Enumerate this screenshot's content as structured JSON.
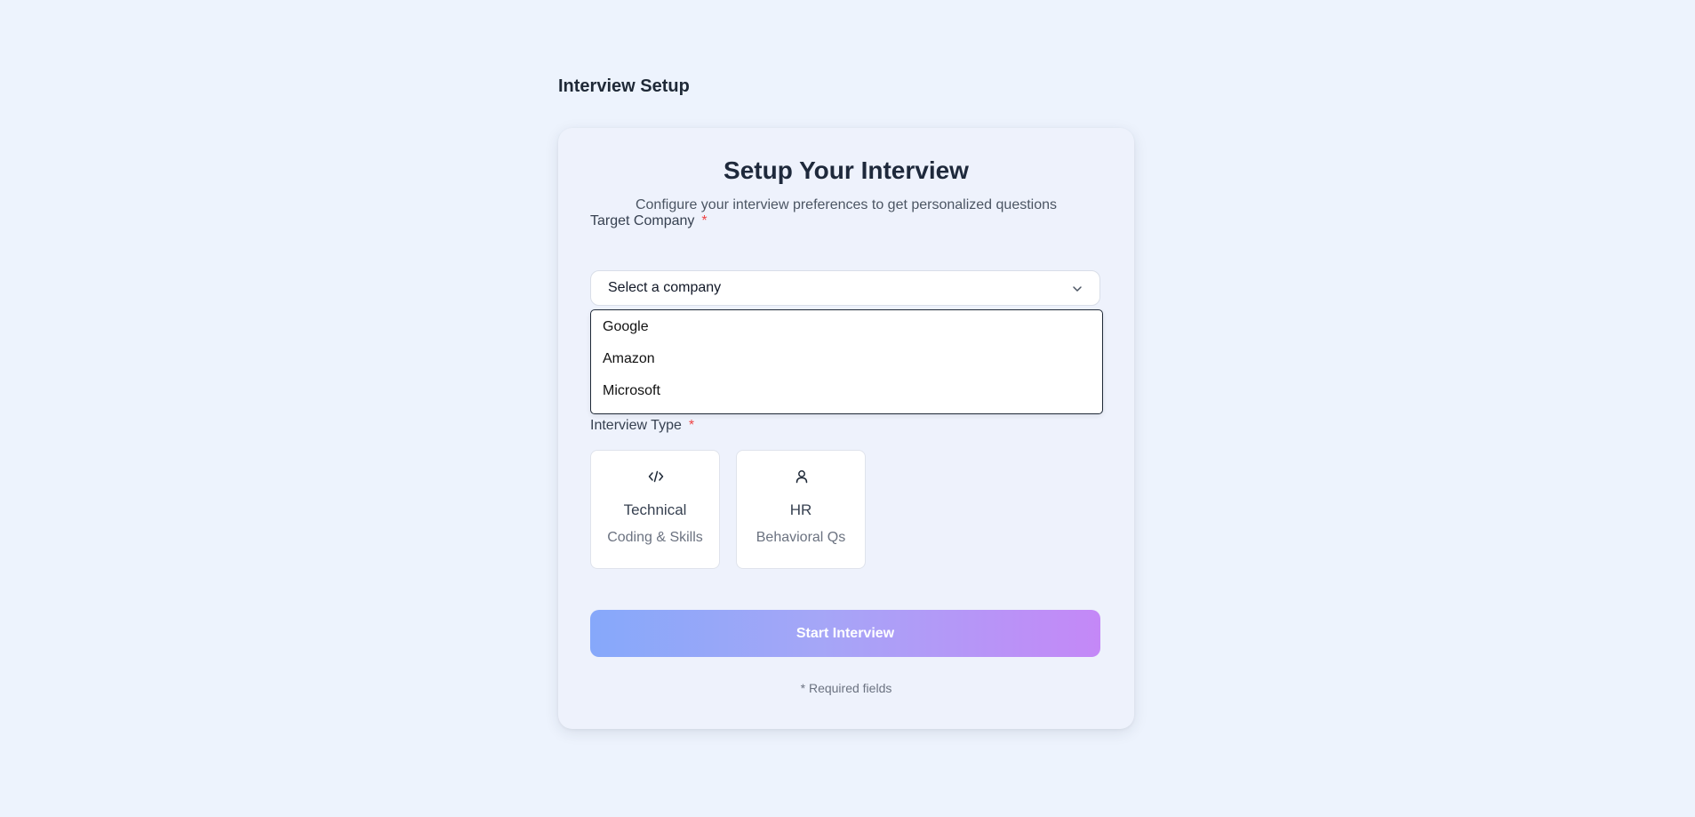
{
  "page": {
    "heading": "Interview Setup"
  },
  "card": {
    "title": "Setup Your Interview",
    "subtitle": "Configure your interview preferences to get personalized questions"
  },
  "company": {
    "label": "Target Company",
    "required_marker": "*",
    "selected_value": "Select a company",
    "options": [
      "Google",
      "Amazon",
      "Microsoft"
    ],
    "dropdown_open": true
  },
  "interview_type": {
    "label": "Interview Type",
    "required_marker": "*",
    "options": [
      {
        "title": "Technical",
        "subtitle": "Coding & Skills",
        "icon": "code-icon"
      },
      {
        "title": "HR",
        "subtitle": "Behavioral Qs",
        "icon": "user-icon"
      }
    ]
  },
  "actions": {
    "start_label": "Start Interview"
  },
  "footer": {
    "required_note": "* Required fields"
  },
  "colors": {
    "background": "#edf3fd",
    "card": "#eef2fc",
    "required": "#ef4444",
    "button_gradient_start": "#86a8fa",
    "button_gradient_end": "#c488f7"
  }
}
